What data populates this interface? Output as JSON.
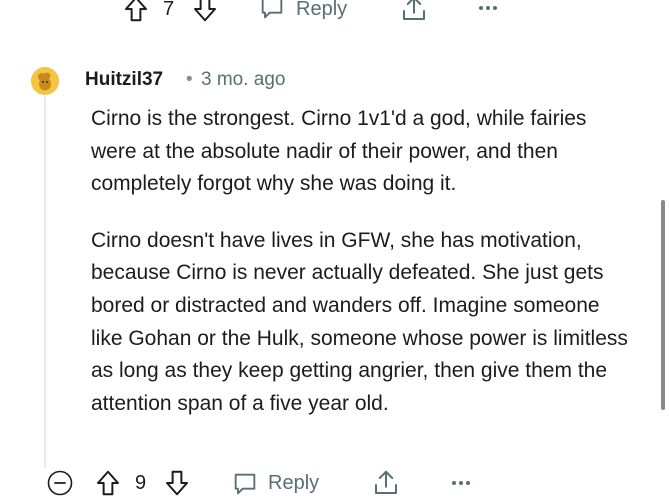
{
  "prev_comment_actions": {
    "vote_count": "7",
    "reply_label": "Reply"
  },
  "comment": {
    "username": "Huitzil37",
    "separator": "•",
    "time_ago": "3 mo. ago",
    "paragraphs": [
      "Cirno is the strongest. Cirno 1v1'd a god, while fairies were at the absolute nadir of their power, and then completely forgot why she was doing it.",
      "Cirno doesn't have lives in GFW, she has motivation, because Cirno is never actually defeated. She just gets bored or distracted and wanders off. Imagine someone like Gohan or the Hulk, someone whose power is limitless as long as they keep getting angrier, then give them the attention span of a five year old."
    ],
    "actions": {
      "vote_count": "9",
      "reply_label": "Reply"
    }
  }
}
